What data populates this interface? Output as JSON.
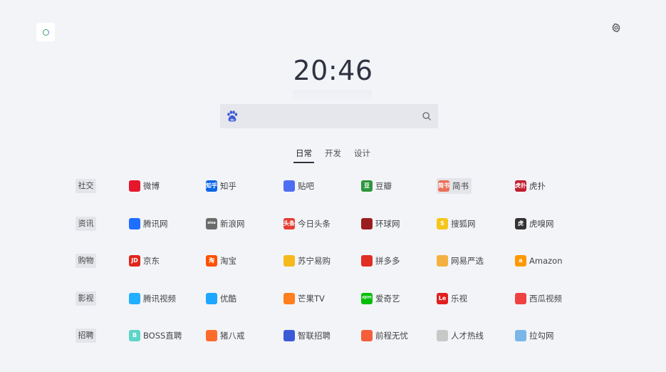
{
  "clock": {
    "time": "20:46"
  },
  "search": {
    "value": "",
    "placeholder": ""
  },
  "tabs": [
    {
      "label": "日常",
      "active": true
    },
    {
      "label": "开发",
      "active": false
    },
    {
      "label": "设计",
      "active": false
    }
  ],
  "categories": [
    {
      "label": "社交",
      "links": [
        {
          "label": "微博",
          "icon": "weibo-icon",
          "color": "#e6162d"
        },
        {
          "label": "知乎",
          "icon": "zhihu-icon",
          "color": "#0a66e6",
          "badge": "知乎"
        },
        {
          "label": "贴吧",
          "icon": "tieba-icon",
          "color": "#4e6ef2"
        },
        {
          "label": "豆瓣",
          "icon": "douban-icon",
          "color": "#2e963d",
          "badge": "豆"
        },
        {
          "label": "简书",
          "icon": "jianshu-icon",
          "color": "#ea6f5a",
          "badge": "简书",
          "highlighted": true
        },
        {
          "label": "虎扑",
          "icon": "hupu-icon",
          "color": "#c01e2f",
          "badge": "虎扑"
        }
      ]
    },
    {
      "label": "资讯",
      "links": [
        {
          "label": "腾讯网",
          "icon": "qq-icon",
          "color": "#1e6fff"
        },
        {
          "label": "新浪网",
          "icon": "sina-icon",
          "color": "#6b6b6b",
          "badge": "sina"
        },
        {
          "label": "今日头条",
          "icon": "toutiao-icon",
          "color": "#e33e33",
          "badge": "头条"
        },
        {
          "label": "环球网",
          "icon": "huanqiu-icon",
          "color": "#9b1e1e"
        },
        {
          "label": "搜狐网",
          "icon": "sohu-icon",
          "color": "#f5c61b",
          "badge": "S"
        },
        {
          "label": "虎嗅网",
          "icon": "huxiu-icon",
          "color": "#333333",
          "badge": "虎"
        }
      ]
    },
    {
      "label": "购物",
      "links": [
        {
          "label": "京东",
          "icon": "jd-icon",
          "color": "#e1251b",
          "badge": "JD"
        },
        {
          "label": "淘宝",
          "icon": "taobao-icon",
          "color": "#ff5000",
          "badge": "淘"
        },
        {
          "label": "苏宁易购",
          "icon": "suning-icon",
          "color": "#f5b91b"
        },
        {
          "label": "拼多多",
          "icon": "pinduoduo-icon",
          "color": "#e02e24"
        },
        {
          "label": "网易严选",
          "icon": "yanxuan-icon",
          "color": "#f4b13f"
        },
        {
          "label": "Amazon",
          "icon": "amazon-icon",
          "color": "#ff9900",
          "badge": "a"
        }
      ]
    },
    {
      "label": "影视",
      "links": [
        {
          "label": "腾讯视频",
          "icon": "tencent-video-icon",
          "color": "#20b0ff"
        },
        {
          "label": "优酷",
          "icon": "youku-icon",
          "color": "#1ea7ff"
        },
        {
          "label": "芒果TV",
          "icon": "mgtv-icon",
          "color": "#ff7e1d"
        },
        {
          "label": "爱奇艺",
          "icon": "iqiyi-icon",
          "color": "#00be06",
          "badge": "iQIYI"
        },
        {
          "label": "乐视",
          "icon": "letv-icon",
          "color": "#e0201f",
          "badge": "Le"
        },
        {
          "label": "西瓜视频",
          "icon": "xigua-icon",
          "color": "#f04142"
        }
      ]
    },
    {
      "label": "招聘",
      "links": [
        {
          "label": "BOSS直聘",
          "icon": "boss-icon",
          "color": "#5dd5c8",
          "badge": "B"
        },
        {
          "label": "猪八戒",
          "icon": "zbj-icon",
          "color": "#ff6b2b"
        },
        {
          "label": "智联招聘",
          "icon": "zhaopin-icon",
          "color": "#3b5bd6"
        },
        {
          "label": "前程无忧",
          "icon": "51job-icon",
          "color": "#f45e3a"
        },
        {
          "label": "人才热线",
          "icon": "cjol-icon",
          "color": "#c8c8c8"
        },
        {
          "label": "拉勾网",
          "icon": "lagou-icon",
          "color": "#7ab6e8"
        }
      ]
    }
  ]
}
